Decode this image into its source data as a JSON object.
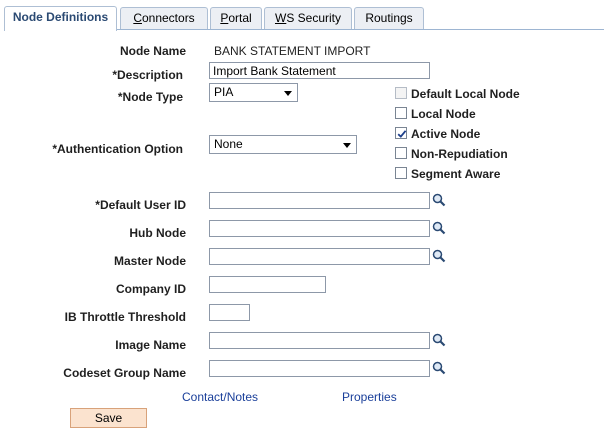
{
  "tabs": [
    {
      "label": "Node Definitions"
    },
    {
      "label": "Connectors",
      "underline": "C",
      "rest": "onnectors"
    },
    {
      "label": "Portal",
      "underline": "P",
      "rest": "ortal"
    },
    {
      "label": "WS Security",
      "underline": "W",
      "rest": "S Security"
    },
    {
      "label": "Routings"
    }
  ],
  "form": {
    "node_name": {
      "label": "Node Name",
      "value": "BANK STATEMENT IMPORT"
    },
    "description": {
      "label": "*Description",
      "value": "Import Bank Statement"
    },
    "node_type": {
      "label": "*Node Type",
      "value": "PIA"
    },
    "auth_option": {
      "label": "*Authentication Option",
      "value": "None"
    },
    "default_user": {
      "label": "*Default User ID",
      "value": ""
    },
    "hub_node": {
      "label": "Hub Node",
      "value": ""
    },
    "master_node": {
      "label": "Master Node",
      "value": ""
    },
    "company_id": {
      "label": "Company ID",
      "value": ""
    },
    "ib_throttle": {
      "label": "IB Throttle Threshold",
      "value": ""
    },
    "image_name": {
      "label": "Image Name",
      "value": ""
    },
    "codeset_group": {
      "label": "Codeset Group Name",
      "value": ""
    }
  },
  "checkboxes": [
    {
      "label": "Default Local Node",
      "checked": false,
      "disabled": true
    },
    {
      "label": "Local Node",
      "checked": false,
      "disabled": false
    },
    {
      "label": "Active Node",
      "checked": true,
      "disabled": false
    },
    {
      "label": "Non-Repudiation",
      "checked": false,
      "disabled": false
    },
    {
      "label": "Segment Aware",
      "checked": false,
      "disabled": false
    }
  ],
  "links": {
    "contact": "Contact/Notes",
    "properties": "Properties"
  },
  "buttons": {
    "save": "Save"
  },
  "colors": {
    "link": "#1a3f9a",
    "save_bg": "#fbe3cf",
    "tab_active_text": "#2b4a73"
  }
}
